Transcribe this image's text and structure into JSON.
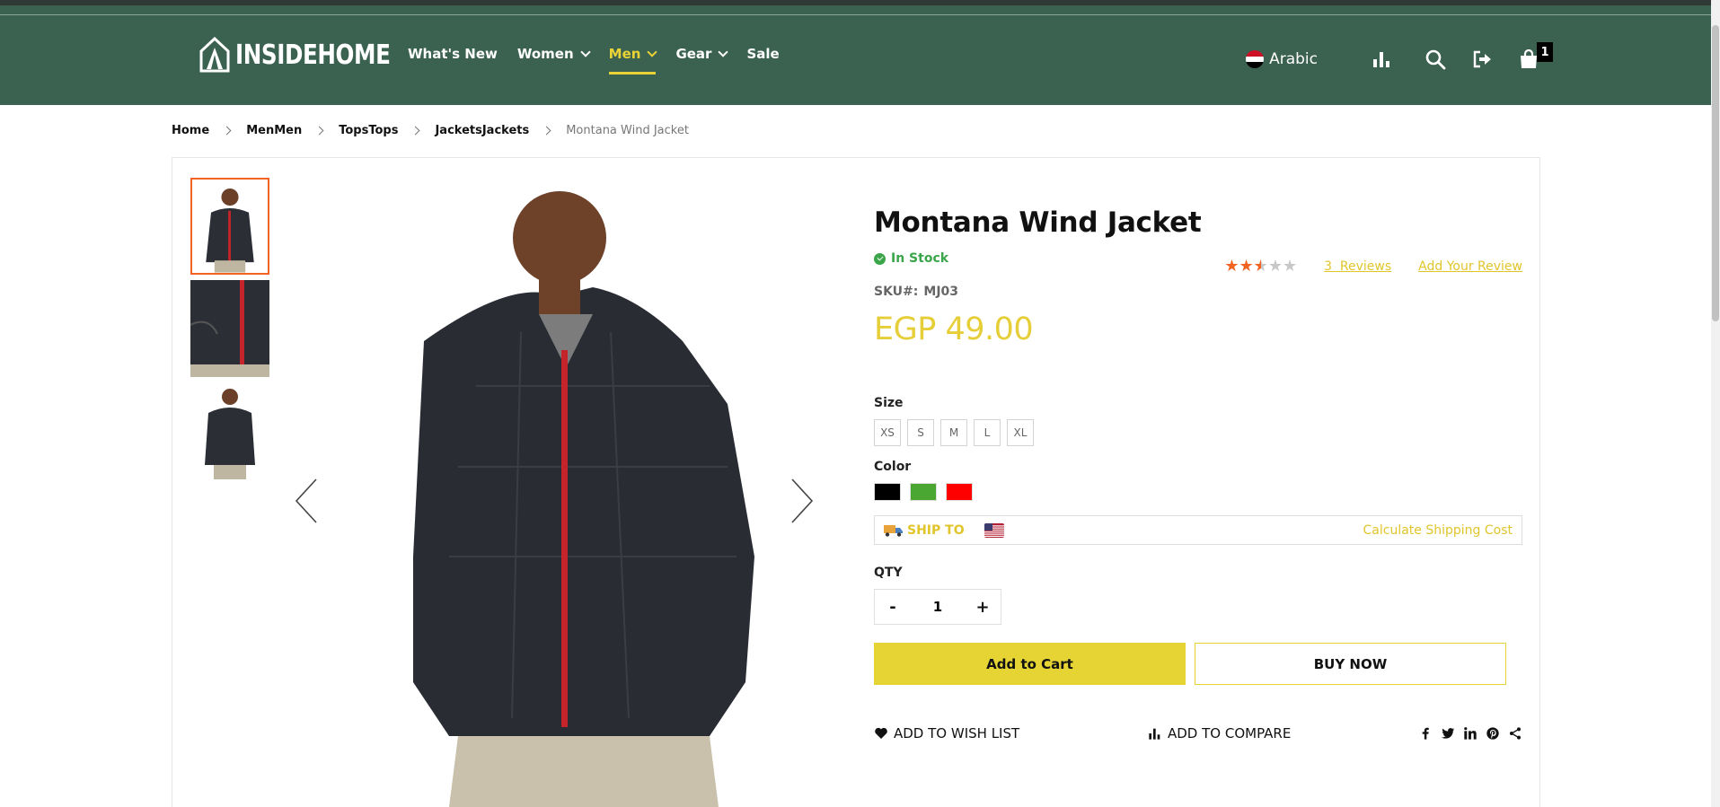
{
  "header": {
    "logo_text": "INSIDEHOME",
    "nav": [
      {
        "label": "What's New",
        "has_dropdown": false,
        "active": false
      },
      {
        "label": "Women",
        "has_dropdown": true,
        "active": false
      },
      {
        "label": "Men",
        "has_dropdown": true,
        "active": true
      },
      {
        "label": "Gear",
        "has_dropdown": true,
        "active": false
      },
      {
        "label": "Sale",
        "has_dropdown": false,
        "active": false
      }
    ],
    "language": "Arabic",
    "cart_count": "1",
    "icons": [
      "compare-icon",
      "search-icon",
      "sign-in-icon",
      "cart-icon"
    ],
    "colors": {
      "bar": "#3b6150",
      "accent": "#e9d336"
    }
  },
  "breadcrumb": {
    "items": [
      "Home",
      "MenMen",
      "TopsTops",
      "JacketsJackets"
    ],
    "current": "Montana Wind Jacket"
  },
  "product": {
    "title": "Montana Wind Jacket",
    "stock": "In Stock",
    "rating_out_of_5": 2.5,
    "reviews_label": "3  Reviews",
    "add_review_label": "Add Your Review",
    "sku_label": "SKU#:",
    "sku": "MJ03",
    "price": "EGP 49.00",
    "size_label": "Size",
    "sizes": [
      "XS",
      "S",
      "M",
      "L",
      "XL"
    ],
    "color_label": "Color",
    "colors": [
      "#000000",
      "#4aa832",
      "#ff0000"
    ],
    "ship_label": "SHIP TO",
    "calc_shipping": "Calculate Shipping Cost",
    "qty_label": "QTY",
    "qty_minus": "-",
    "qty_plus": "+",
    "qty_value": "1",
    "add_to_cart": "Add to Cart",
    "buy_now": "BUY NOW",
    "wishlist": "ADD TO WISH LIST",
    "compare": "ADD TO COMPARE",
    "social": [
      "facebook-icon",
      "twitter-icon",
      "linkedin-icon",
      "pinterest-icon",
      "share-icon"
    ]
  }
}
